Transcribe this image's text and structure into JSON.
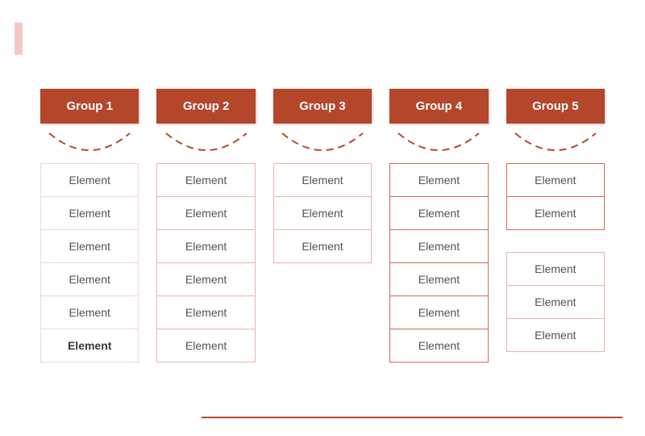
{
  "colors": {
    "headerBg": "#b3462b",
    "accentBar": "#f7c7c7",
    "elementBorderLight": "#f5d5d0",
    "elementBorderMed": "#e9b3ad",
    "elementBorderStrong": "#cf6b57",
    "footerRule": "#b8482e",
    "elementText": "#56524f"
  },
  "groups": {
    "g1": {
      "header": "Group 1",
      "elements": [
        "Element",
        "Element",
        "Element",
        "Element",
        "Element",
        "Element"
      ]
    },
    "g2": {
      "header": "Group 2",
      "elements": [
        "Element",
        "Element",
        "Element",
        "Element",
        "Element",
        "Element"
      ]
    },
    "g3": {
      "header": "Group 3",
      "elements": [
        "Element",
        "Element",
        "Element"
      ]
    },
    "g4": {
      "header": "Group 4",
      "elements": [
        "Element",
        "Element",
        "Element",
        "Element",
        "Element",
        "Element"
      ]
    },
    "g5": {
      "header": "Group 5",
      "stackA": [
        "Element",
        "Element"
      ],
      "stackB": [
        "Element",
        "Element",
        "Element"
      ]
    }
  }
}
